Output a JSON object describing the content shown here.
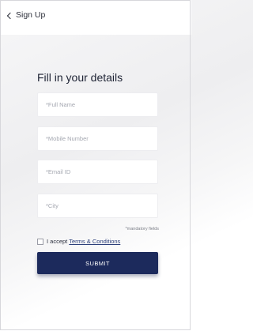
{
  "header": {
    "back_label": "Sign Up"
  },
  "form": {
    "title": "Fill in your details",
    "fields": [
      {
        "placeholder": "*Full Name",
        "value": ""
      },
      {
        "placeholder": "*Mobile Number",
        "value": ""
      },
      {
        "placeholder": "*Email ID",
        "value": ""
      },
      {
        "placeholder": "*City",
        "value": ""
      }
    ],
    "mandatory_note": "*mandatory fields",
    "accept_label": "I accept",
    "terms_link": "Terms & Conditions",
    "accept_checked": false,
    "submit_label": "SUBMIT"
  },
  "colors": {
    "submit_bg": "#1c2a5c",
    "link": "#2c3f7a"
  }
}
